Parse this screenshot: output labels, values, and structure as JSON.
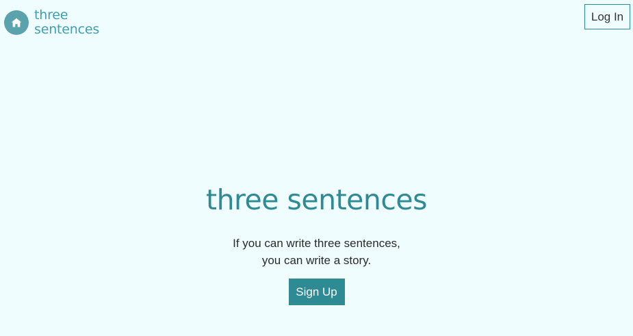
{
  "header": {
    "logo": {
      "icon": "home-icon",
      "line1": "three",
      "line2": "sentences"
    },
    "login_label": "Log In"
  },
  "hero": {
    "title": "three sentences",
    "tagline_line1": "If you can write three sentences,",
    "tagline_line2": "you can write a story.",
    "signup_label": "Sign Up"
  },
  "colors": {
    "background": "#effdfe",
    "brand_teal": "#2e8a93",
    "logo_badge": "#5aa3ad",
    "logo_text": "#3e9fb1"
  }
}
